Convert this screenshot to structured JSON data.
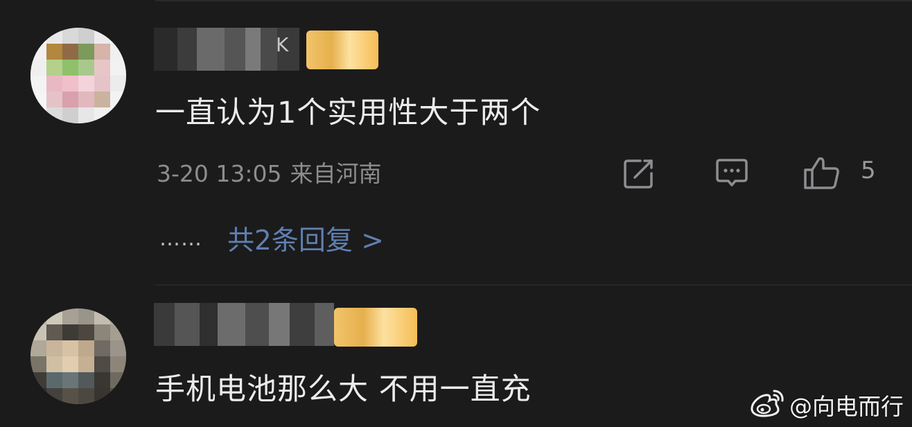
{
  "comments": [
    {
      "username": "K",
      "text": "一直认为1个实用性大于两个",
      "timestamp": "3-20 13:05",
      "location": "来自河南",
      "like_count": "5",
      "replies_dots": "……",
      "replies_link": "共2条回复 >",
      "avatar_icon": "pixelated-avatar",
      "badge_icon": "vip-badge"
    },
    {
      "username": "",
      "text": "手机电池那么大 不用一直充",
      "avatar_icon": "pixelated-avatar",
      "badge_icon": "vip-badge"
    }
  ],
  "icons": {
    "share": "share-icon",
    "reply": "comment-icon",
    "like": "thumbs-up-icon"
  },
  "watermark": {
    "text": "@向电而行",
    "logo": "weibo-logo"
  },
  "colors": {
    "background": "#1b1b1c",
    "text_primary": "#ececec",
    "text_secondary": "#8d8d90",
    "link": "#5f7fb0",
    "badge_gold": "#f2c46b"
  }
}
